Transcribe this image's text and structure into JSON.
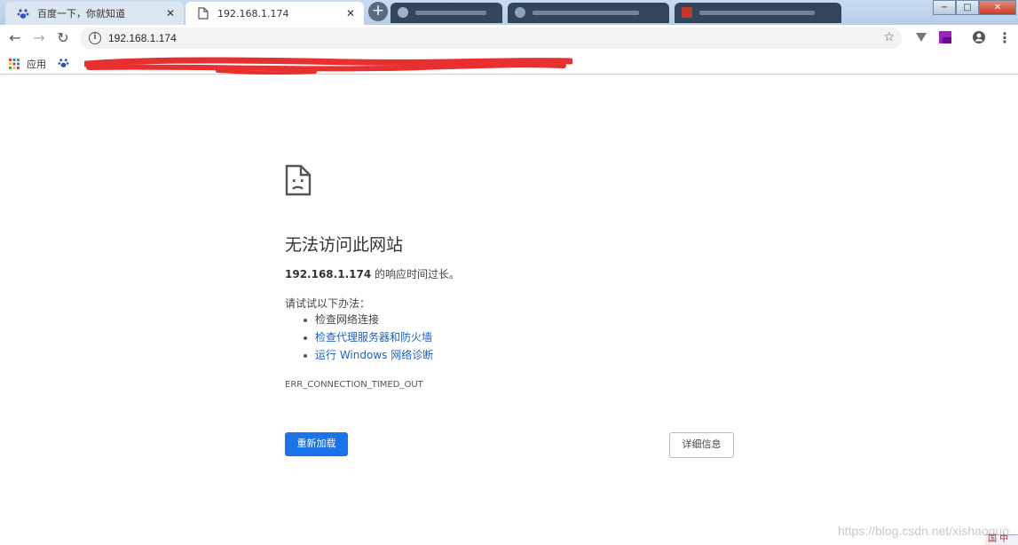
{
  "tabs": [
    {
      "title": "百度一下，你就知道",
      "close": "✕",
      "favicon": "baidu-paw-icon"
    },
    {
      "title": "192.168.1.174",
      "close": "✕",
      "favicon": "page-icon"
    }
  ],
  "newtab_label": "+",
  "window_buttons": {
    "minimize": "−",
    "maximize": "□",
    "close": "✕"
  },
  "toolbar": {
    "back": "←",
    "forward": "→",
    "reload": "↻",
    "url": "192.168.1.174",
    "bookmark_star": "☆",
    "account_icon": "account-circle-icon",
    "menu": "⋮"
  },
  "bookmarks": {
    "apps_label": "应用"
  },
  "error": {
    "heading": "无法访问此网站",
    "host": "192.168.1.174",
    "host_suffix": " 的响应时间过长。",
    "try_label": "请试试以下办法：",
    "suggestions": [
      {
        "text": "检查网络连接",
        "link": false
      },
      {
        "text": "检查代理服务器和防火墙",
        "link": true
      },
      {
        "text": "运行 Windows 网络诊断",
        "link": true
      }
    ],
    "code": "ERR_CONNECTION_TIMED_OUT",
    "reload_button": "重新加载",
    "details_button": "详细信息"
  },
  "watermark": "https://blog.csdn.net/xishaoguo",
  "taskbar_corner": "国 中",
  "colors": {
    "accent": "#1a73e8",
    "link": "#1a60c5",
    "redaction": "#e83030"
  }
}
